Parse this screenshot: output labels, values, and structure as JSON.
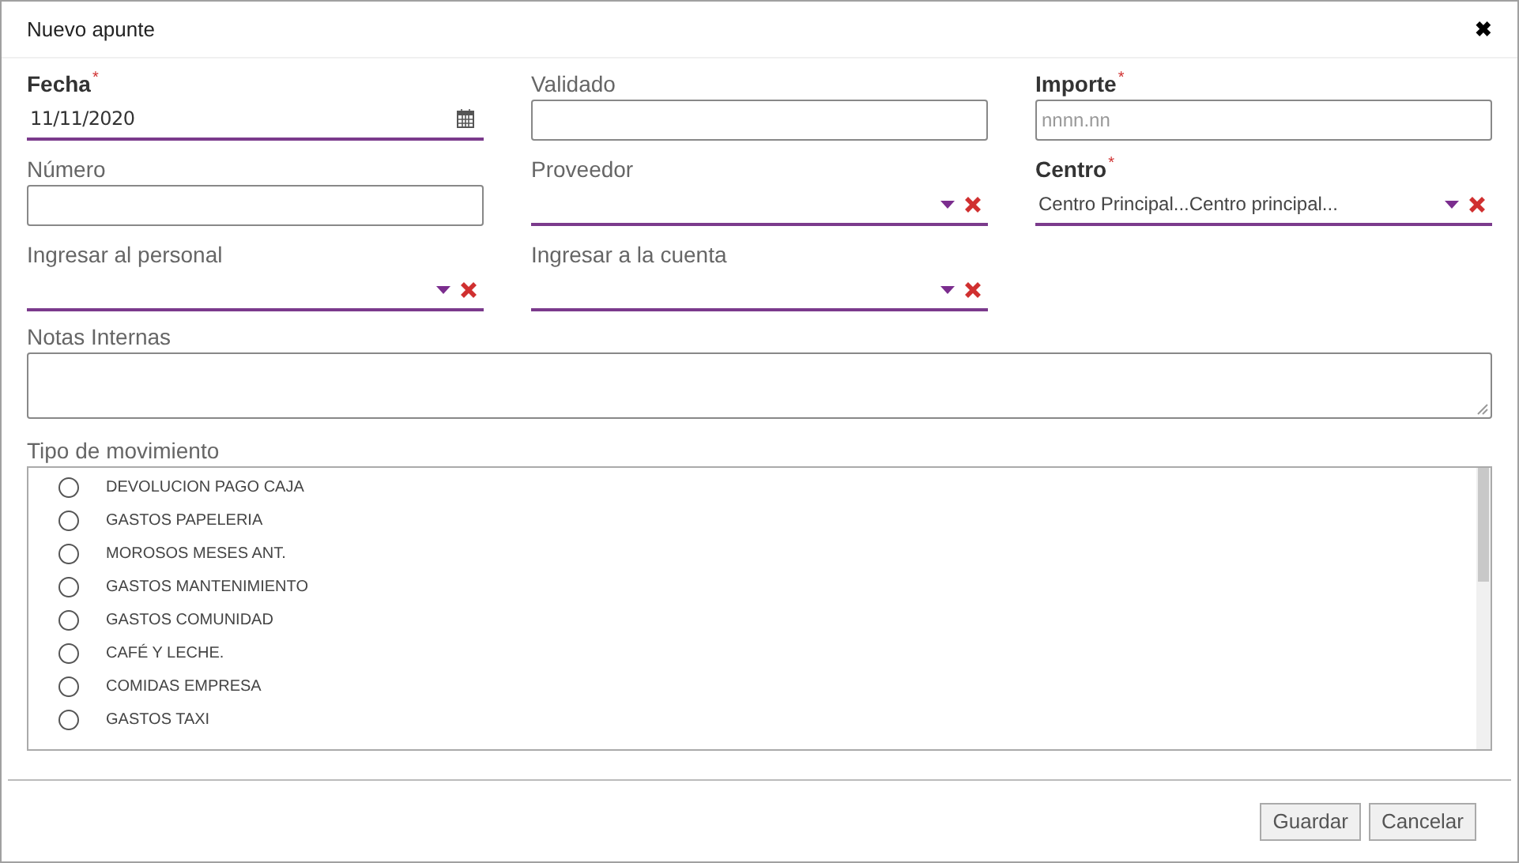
{
  "window": {
    "title": "Nuevo apunte",
    "close": "✖"
  },
  "field_rows": [
    [
      {
        "kind": "date",
        "label": "Fecha",
        "required_mark": "*",
        "value": "11/11/2020"
      },
      {
        "kind": "text",
        "label": "Validado"
      },
      {
        "kind": "text",
        "label": "Importe",
        "required_mark": "*",
        "placeholder": "nnnn.nn"
      }
    ],
    [
      {
        "kind": "text",
        "label": "Número"
      },
      {
        "kind": "select",
        "label": "Proveedor"
      },
      {
        "kind": "select",
        "label": "Centro",
        "required_mark": "*",
        "value": "Centro Principal...Centro principal..."
      }
    ],
    [
      {
        "kind": "select",
        "label": "Ingresar al personal"
      },
      {
        "kind": "select",
        "label": "Ingresar a la cuenta"
      }
    ]
  ],
  "notes": {
    "label": "Notas Internas"
  },
  "movement_type": {
    "label": "Tipo de movimiento",
    "options": [
      {
        "label": "DEVOLUCION PAGO CAJA",
        "selected": false
      },
      {
        "label": "GASTOS PAPELERIA",
        "selected": false
      },
      {
        "label": "MOROSOS MESES ANT.",
        "selected": false
      },
      {
        "label": "GASTOS MANTENIMIENTO",
        "selected": false
      },
      {
        "label": "GASTOS COMUNIDAD",
        "selected": false
      },
      {
        "label": "CAFÉ Y LECHE.",
        "selected": false
      },
      {
        "label": "COMIDAS EMPRESA",
        "selected": false
      },
      {
        "label": "GASTOS TAXI",
        "selected": false
      }
    ]
  },
  "buttons": [
    "Guardar",
    "Cancelar"
  ]
}
